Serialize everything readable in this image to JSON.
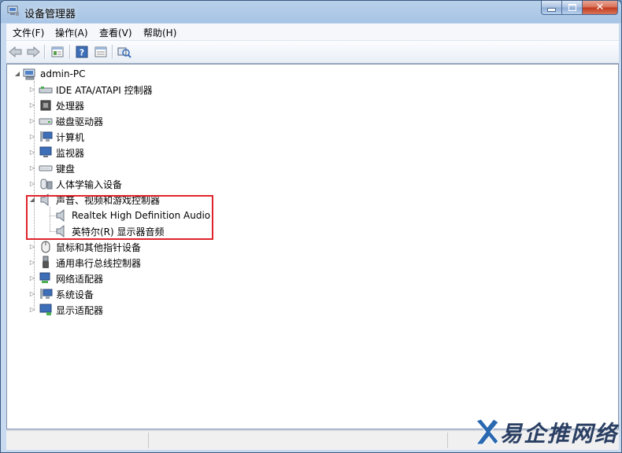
{
  "window": {
    "title": "设备管理器"
  },
  "menu": [
    "文件(F)",
    "操作(A)",
    "查看(V)",
    "帮助(H)"
  ],
  "toolbar": {
    "buttons": [
      "back-icon",
      "forward-icon",
      "properties-view-icon",
      "help-icon",
      "view-icon",
      "scan-hardware-icon"
    ]
  },
  "tree": {
    "root": "admin-PC",
    "categories_before": [
      {
        "label": "IDE ATA/ATAPI 控制器",
        "icon": "ide-controller-icon"
      },
      {
        "label": "处理器",
        "icon": "processor-icon"
      },
      {
        "label": "磁盘驱动器",
        "icon": "disk-drive-icon"
      },
      {
        "label": "计算机",
        "icon": "computer-icon"
      },
      {
        "label": "监视器",
        "icon": "monitor-icon"
      },
      {
        "label": "键盘",
        "icon": "keyboard-icon"
      },
      {
        "label": "人体学输入设备",
        "icon": "hid-icon"
      }
    ],
    "expanded": {
      "label": "声音、视频和游戏控制器",
      "icon": "speaker-icon",
      "children": [
        {
          "label": "Realtek High Definition Audio",
          "icon": "speaker-icon"
        },
        {
          "label": "英特尔(R) 显示器音频",
          "icon": "speaker-icon"
        }
      ]
    },
    "categories_after": [
      {
        "label": "鼠标和其他指针设备",
        "icon": "mouse-icon"
      },
      {
        "label": "通用串行总线控制器",
        "icon": "usb-icon"
      },
      {
        "label": "网络适配器",
        "icon": "network-adapter-icon"
      },
      {
        "label": "系统设备",
        "icon": "system-device-icon"
      },
      {
        "label": "显示适配器",
        "icon": "display-adapter-icon"
      }
    ]
  },
  "watermark": {
    "text": "易企推网络"
  },
  "colors": {
    "highlight": "#e0242c",
    "title_bar": "#a7c4e5"
  }
}
